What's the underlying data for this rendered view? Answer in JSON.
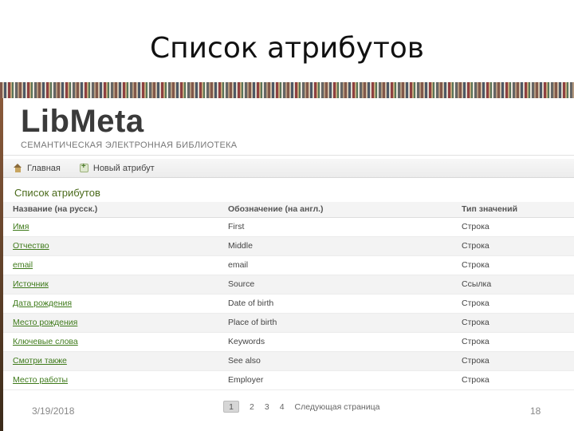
{
  "slide": {
    "title": "Список атрибутов",
    "date": "3/19/2018",
    "page_number": "18"
  },
  "site": {
    "logo": "LibMeta",
    "tagline": "СЕМАНТИЧЕСКАЯ ЭЛЕКТРОННАЯ БИБЛИОТЕКА"
  },
  "nav": {
    "home_label": "Главная",
    "new_attr_label": "Новый атрибут"
  },
  "section_title": "Список атрибутов",
  "table": {
    "headers": [
      "Название (на русск.)",
      "Обозначение (на англ.)",
      "Тип значений"
    ],
    "rows": [
      {
        "name": "Имя",
        "code": "First",
        "type": "Строка"
      },
      {
        "name": "Отчество",
        "code": "Middle",
        "type": "Строка"
      },
      {
        "name": "email",
        "code": "email",
        "type": "Строка"
      },
      {
        "name": "Источник",
        "code": "Source",
        "type": "Ссылка"
      },
      {
        "name": "Дата рождения",
        "code": "Date of birth",
        "type": "Строка"
      },
      {
        "name": "Место рождения",
        "code": "Place of birth",
        "type": "Строка"
      },
      {
        "name": "Ключевые слова",
        "code": "Keywords",
        "type": "Строка"
      },
      {
        "name": "Смотри также",
        "code": "See also",
        "type": "Строка"
      },
      {
        "name": "Место работы",
        "code": "Employer",
        "type": "Строка"
      }
    ]
  },
  "pager": {
    "current": "1",
    "pages": [
      "2",
      "3",
      "4"
    ],
    "next_label": "Следующая страница"
  }
}
